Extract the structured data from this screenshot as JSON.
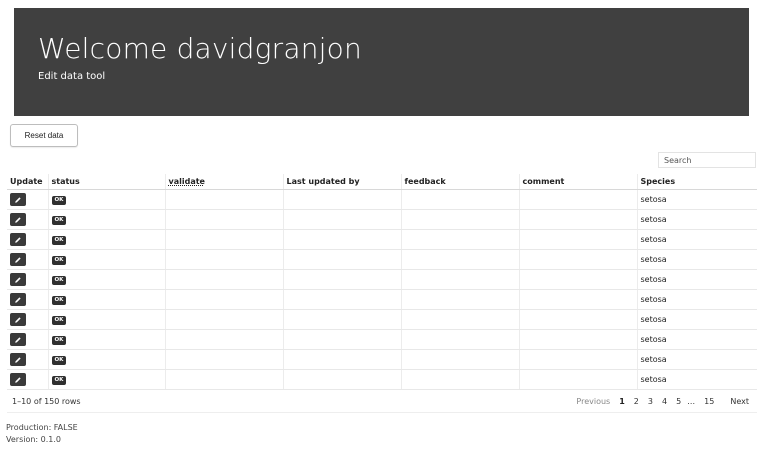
{
  "header": {
    "title": "Welcome davidgranjon",
    "subtitle": "Edit data tool"
  },
  "toolbar": {
    "reset_label": "Reset data"
  },
  "search": {
    "placeholder": "Search"
  },
  "table": {
    "columns": [
      "Update",
      "status",
      "validate",
      "Last updated by",
      "feedback",
      "comment",
      "Species"
    ],
    "rows": [
      {
        "status": "OK",
        "validate": "",
        "last_updated_by": "",
        "feedback": "",
        "comment": "",
        "species": "setosa"
      },
      {
        "status": "OK",
        "validate": "",
        "last_updated_by": "",
        "feedback": "",
        "comment": "",
        "species": "setosa"
      },
      {
        "status": "OK",
        "validate": "",
        "last_updated_by": "",
        "feedback": "",
        "comment": "",
        "species": "setosa"
      },
      {
        "status": "OK",
        "validate": "",
        "last_updated_by": "",
        "feedback": "",
        "comment": "",
        "species": "setosa"
      },
      {
        "status": "OK",
        "validate": "",
        "last_updated_by": "",
        "feedback": "",
        "comment": "",
        "species": "setosa"
      },
      {
        "status": "OK",
        "validate": "",
        "last_updated_by": "",
        "feedback": "",
        "comment": "",
        "species": "setosa"
      },
      {
        "status": "OK",
        "validate": "",
        "last_updated_by": "",
        "feedback": "",
        "comment": "",
        "species": "setosa"
      },
      {
        "status": "OK",
        "validate": "",
        "last_updated_by": "",
        "feedback": "",
        "comment": "",
        "species": "setosa"
      },
      {
        "status": "OK",
        "validate": "",
        "last_updated_by": "",
        "feedback": "",
        "comment": "",
        "species": "setosa"
      },
      {
        "status": "OK",
        "validate": "",
        "last_updated_by": "",
        "feedback": "",
        "comment": "",
        "species": "setosa"
      }
    ],
    "edit_icon": "pencil-icon"
  },
  "pagination": {
    "info": "1–10 of 150 rows",
    "previous": "Previous",
    "pages": [
      "1",
      "2",
      "3",
      "4",
      "5",
      "…",
      "15"
    ],
    "current": "1",
    "next": "Next"
  },
  "footer": {
    "production": "Production: FALSE",
    "version": "Version: 0.1.0"
  },
  "colors": {
    "banner_bg": "#404040",
    "button_dark": "#3a3a3a"
  }
}
